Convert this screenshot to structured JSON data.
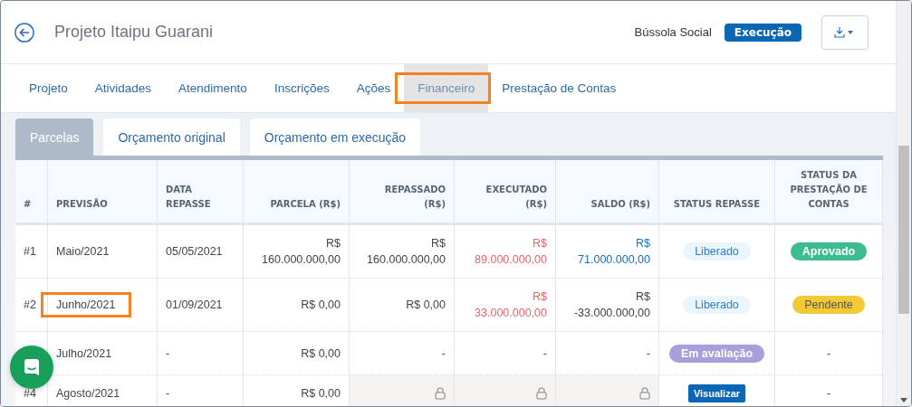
{
  "header": {
    "title": "Projeto Itaipu Guarani",
    "org": "Bússola Social",
    "status": "Execução"
  },
  "nav": [
    {
      "label": "Projeto",
      "selected": false,
      "highlighted": false
    },
    {
      "label": "Atividades",
      "selected": false,
      "highlighted": false
    },
    {
      "label": "Atendimento",
      "selected": false,
      "highlighted": false
    },
    {
      "label": "Inscrições",
      "selected": false,
      "highlighted": false
    },
    {
      "label": "Ações",
      "selected": false,
      "highlighted": false
    },
    {
      "label": "Financeiro",
      "selected": true,
      "highlighted": true
    },
    {
      "label": "Prestação de Contas",
      "selected": false,
      "highlighted": false
    }
  ],
  "subtabs": [
    {
      "label": "Parcelas",
      "selected": true
    },
    {
      "label": "Orçamento original",
      "selected": false
    },
    {
      "label": "Orçamento em execução",
      "selected": false
    }
  ],
  "table": {
    "columns": [
      "#",
      "PREVISÃO",
      "DATA\nREPASSE",
      "PARCELA (R$)",
      "REPASSADO\n(R$)",
      "EXECUTADO\n(R$)",
      "SALDO (R$)",
      "STATUS REPASSE",
      "STATUS DA\nPRESTAÇÃO DE\nCONTAS"
    ],
    "rows": [
      {
        "cells": [
          {
            "kind": "text",
            "text": "#1"
          },
          {
            "kind": "text",
            "text": "Maio/2021"
          },
          {
            "kind": "text",
            "text": "05/05/2021"
          },
          {
            "kind": "money",
            "text": "R$\n160.000.000,00",
            "color": "#444444"
          },
          {
            "kind": "money",
            "text": "R$\n160.000.000,00",
            "color": "#444444"
          },
          {
            "kind": "money",
            "text": "R$\n89.000.000,00",
            "color": "#e5646a"
          },
          {
            "kind": "money",
            "text": "R$\n71.000.000,00",
            "color": "#1a6fbd"
          },
          {
            "kind": "badge",
            "text": "Liberado",
            "color": "#eaf5fd"
          },
          {
            "kind": "badge",
            "text": "Aprovado",
            "color": "#3dbd8e"
          }
        ]
      },
      {
        "cells": [
          {
            "kind": "text",
            "text": "#2"
          },
          {
            "kind": "text",
            "text": "Junho/2021",
            "highlighted": true
          },
          {
            "kind": "text",
            "text": "01/09/2021"
          },
          {
            "kind": "money",
            "text": "R$ 0,00",
            "color": "#444444"
          },
          {
            "kind": "money",
            "text": "R$ 0,00",
            "color": "#444444"
          },
          {
            "kind": "money",
            "text": "R$\n33.000.000,00",
            "color": "#e5646a"
          },
          {
            "kind": "money",
            "text": "R$\n-33.000.000,00",
            "color": "#444444"
          },
          {
            "kind": "badge",
            "text": "Liberado",
            "color": "#eaf5fd"
          },
          {
            "kind": "badge",
            "text": "Pendente",
            "color": "#f3c936"
          }
        ]
      },
      {
        "cells": [
          {
            "kind": "blank"
          },
          {
            "kind": "text",
            "text": "Julho/2021"
          },
          {
            "kind": "text",
            "text": "-"
          },
          {
            "kind": "money",
            "text": "R$ 0,00",
            "color": "#444444"
          },
          {
            "kind": "right",
            "text": "-"
          },
          {
            "kind": "right",
            "text": "-"
          },
          {
            "kind": "right",
            "text": "-"
          },
          {
            "kind": "badge",
            "text": "Em avaliação",
            "color": "#a99ddb"
          },
          {
            "kind": "center",
            "text": "-"
          }
        ]
      },
      {
        "cells": [
          {
            "kind": "text",
            "text": "#4"
          },
          {
            "kind": "text",
            "text": "Agosto/2021"
          },
          {
            "kind": "text",
            "text": "-"
          },
          {
            "kind": "money",
            "text": "R$ 0,00",
            "color": "#444444"
          },
          {
            "kind": "lock"
          },
          {
            "kind": "lock"
          },
          {
            "kind": "lock"
          },
          {
            "kind": "button",
            "text": "Visualizar"
          },
          {
            "kind": "center",
            "text": "-"
          }
        ]
      }
    ]
  }
}
